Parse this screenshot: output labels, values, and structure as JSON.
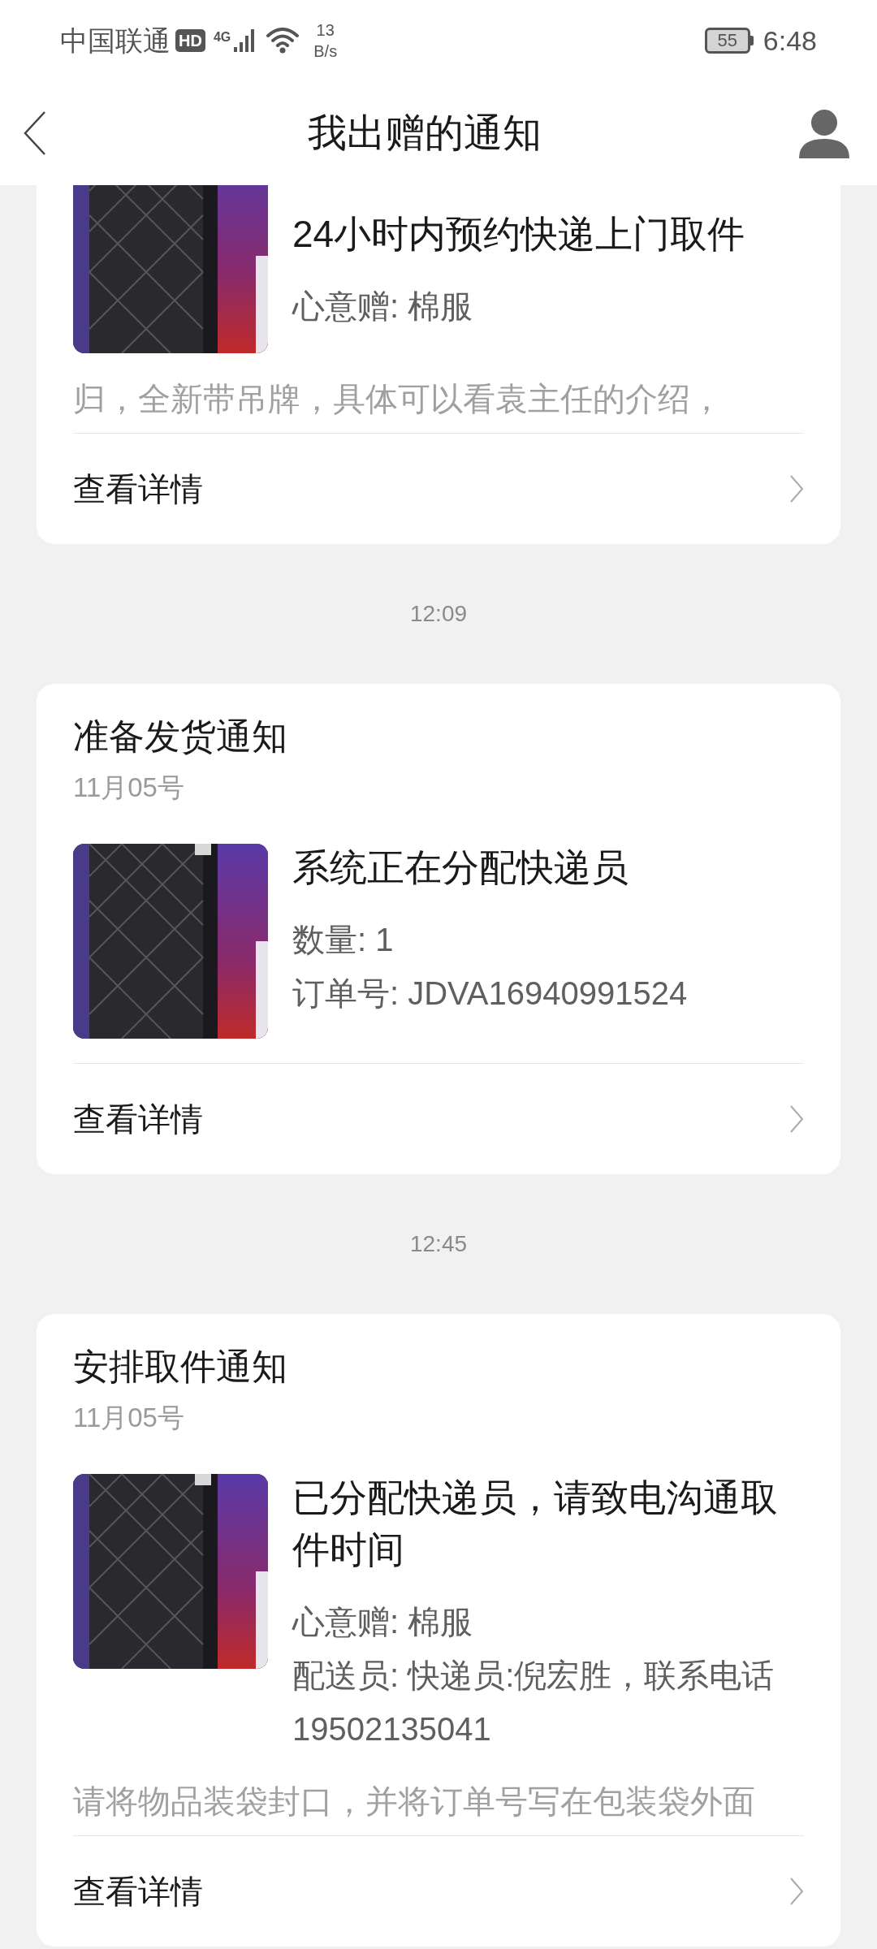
{
  "status_bar": {
    "carrier": "中国联通",
    "hd": "HD",
    "network": "4G",
    "speed_value": "13",
    "speed_unit": "B/s",
    "battery": "55",
    "time": "6:48"
  },
  "header": {
    "title": "我出赠的通知"
  },
  "notifications": [
    {
      "headline": "24小时内预约快递上门取件",
      "lines": [
        "心意赠: 棉服"
      ],
      "note": "归，全新带吊牌，具体可以看袁主任的介绍，",
      "details": "查看详情"
    },
    {
      "time": "12:09",
      "title": "准备发货通知",
      "date": "11月05号",
      "headline": "系统正在分配快递员",
      "lines": [
        "数量: 1",
        "订单号: JDVA16940991524"
      ],
      "details": "查看详情"
    },
    {
      "time": "12:45",
      "title": "安排取件通知",
      "date": "11月05号",
      "headline": "已分配快递员，请致电沟通取件时间",
      "lines": [
        "心意赠: 棉服",
        "配送员: 快递员:倪宏胜，联系电话19502135041"
      ],
      "note": "请将物品装袋封口，并将订单号写在包装袋外面",
      "details": "查看详情"
    }
  ]
}
